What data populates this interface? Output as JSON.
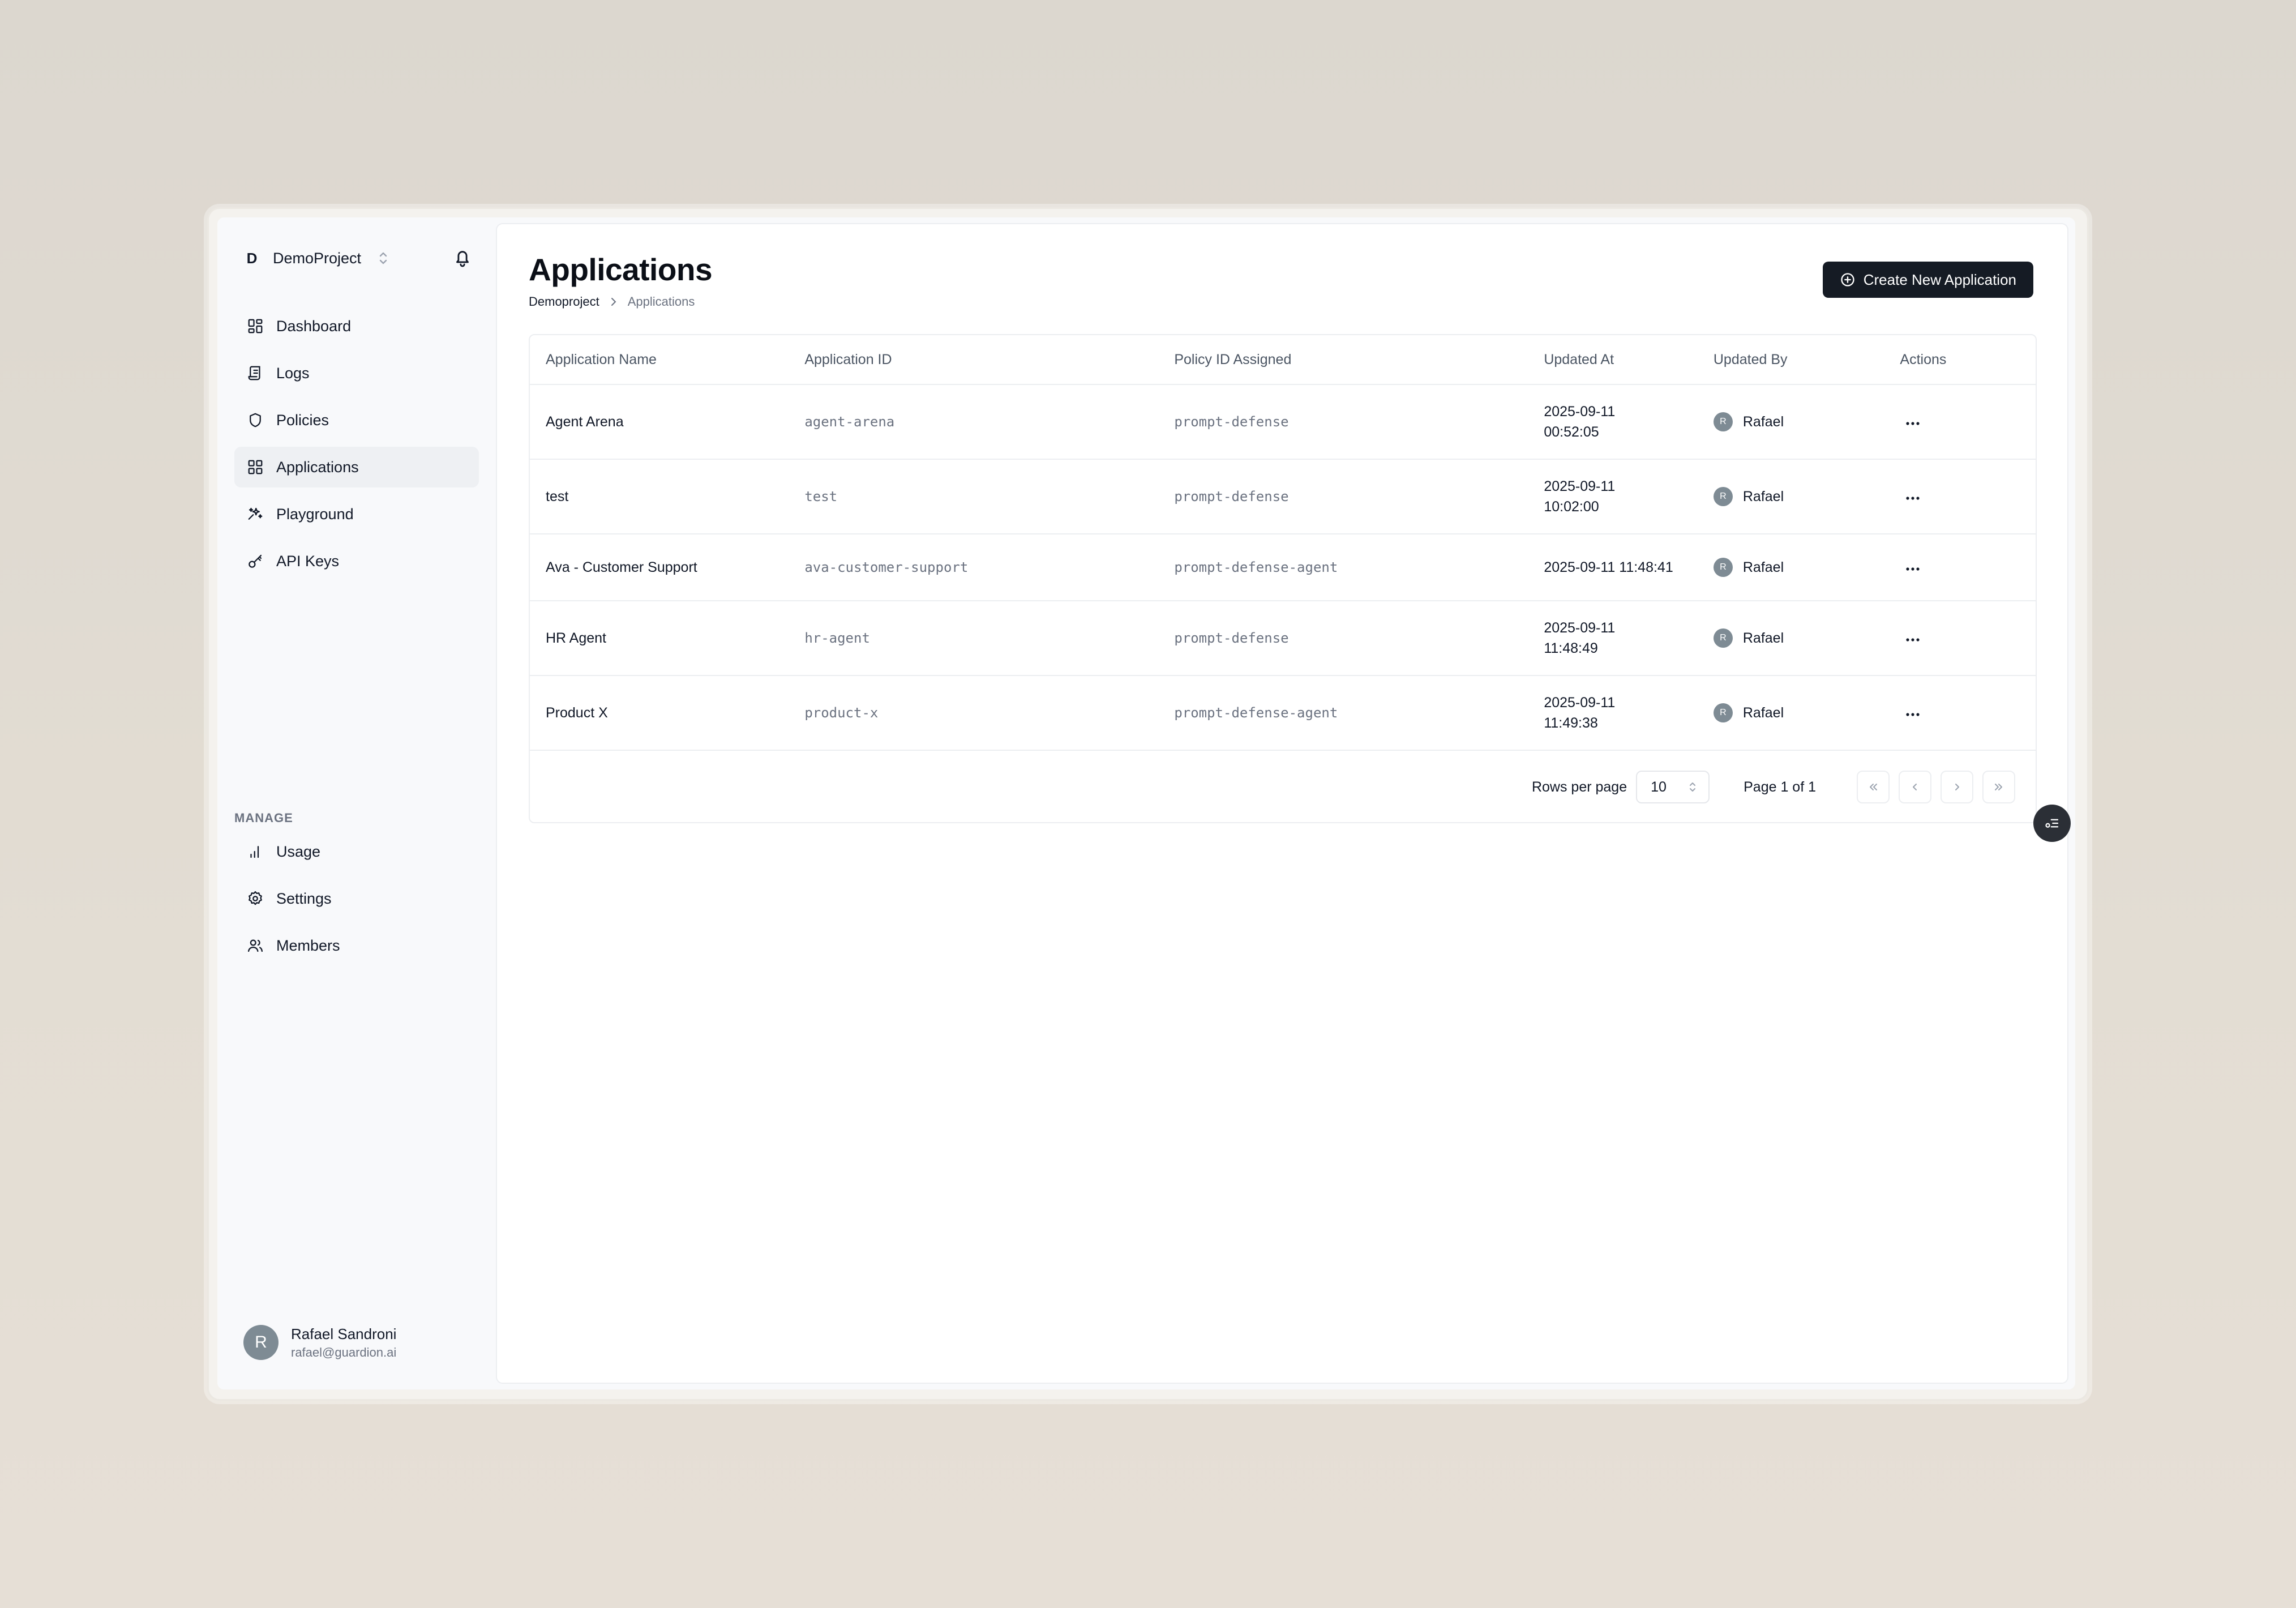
{
  "project": {
    "initial": "D",
    "name": "DemoProject"
  },
  "nav": {
    "items": [
      {
        "label": "Dashboard",
        "icon": "dashboard-icon"
      },
      {
        "label": "Logs",
        "icon": "logs-icon"
      },
      {
        "label": "Policies",
        "icon": "shield-icon"
      },
      {
        "label": "Applications",
        "icon": "applications-icon",
        "active": true
      },
      {
        "label": "Playground",
        "icon": "sparkles-icon"
      },
      {
        "label": "API Keys",
        "icon": "key-icon"
      }
    ],
    "section_label": "MANAGE",
    "manage_items": [
      {
        "label": "Usage",
        "icon": "bar-chart-icon"
      },
      {
        "label": "Settings",
        "icon": "gear-icon"
      },
      {
        "label": "Members",
        "icon": "users-icon"
      }
    ]
  },
  "user": {
    "initial": "R",
    "name": "Rafael Sandroni",
    "email": "rafael@guardion.ai"
  },
  "page": {
    "title": "Applications",
    "breadcrumb": {
      "root": "Demoproject",
      "current": "Applications"
    },
    "create_button": "Create New Application"
  },
  "table": {
    "headers": [
      "Application Name",
      "Application ID",
      "Policy ID Assigned",
      "Updated At",
      "Updated By",
      "Actions"
    ],
    "rows": [
      {
        "name": "Agent Arena",
        "id": "agent-arena",
        "policy": "prompt-defense",
        "date": "2025-09-11",
        "time": "00:52:05",
        "by_initial": "R",
        "by": "Rafael"
      },
      {
        "name": "test",
        "id": "test",
        "policy": "prompt-defense",
        "date": "2025-09-11",
        "time": "10:02:00",
        "by_initial": "R",
        "by": "Rafael"
      },
      {
        "name": "Ava - Customer Support",
        "id": "ava-customer-support",
        "policy": "prompt-defense-agent",
        "date": "2025-09-11 11:48:41",
        "time": "",
        "by_initial": "R",
        "by": "Rafael"
      },
      {
        "name": "HR Agent",
        "id": "hr-agent",
        "policy": "prompt-defense",
        "date": "2025-09-11",
        "time": "11:48:49",
        "by_initial": "R",
        "by": "Rafael"
      },
      {
        "name": "Product X",
        "id": "product-x",
        "policy": "prompt-defense-agent",
        "date": "2025-09-11",
        "time": "11:49:38",
        "by_initial": "R",
        "by": "Rafael"
      }
    ]
  },
  "pagination": {
    "rows_label": "Rows per page",
    "rows_value": "10",
    "page_label": "Page 1 of 1"
  },
  "colors": {
    "primary_button": "#151b24",
    "avatar": "#7e8b94",
    "active_nav": "#eef0f3"
  }
}
